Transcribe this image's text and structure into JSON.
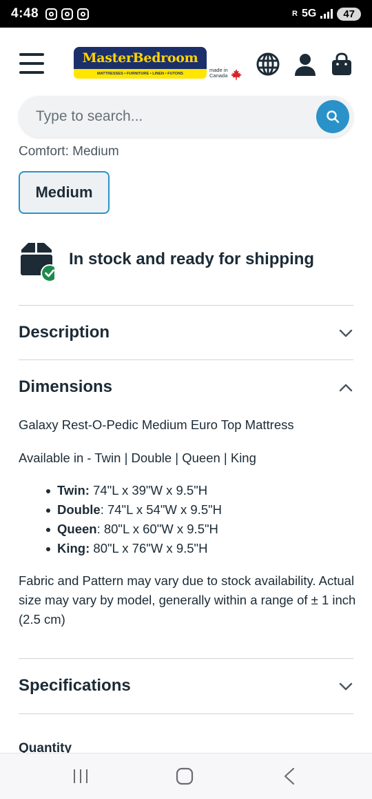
{
  "status_bar": {
    "time": "4:48",
    "network_label": "5G",
    "signal_label": "R",
    "battery": "47"
  },
  "header": {
    "logo_main": "MasterBedroom",
    "logo_tagline": "MATTRESSES  •  FURNITURE  •  LINEN  •  FUTONS",
    "made_in": "made in",
    "canada": "Canada",
    "icons": [
      "menu-icon",
      "globe-icon",
      "account-icon",
      "shopping-bag-icon"
    ]
  },
  "search": {
    "placeholder": "Type to search...",
    "value": ""
  },
  "comfort": {
    "label_partial": "Comfort: Medium",
    "option": "Medium"
  },
  "stock": {
    "text": "In stock and ready for shipping"
  },
  "accordions": {
    "description": "Description",
    "dimensions": "Dimensions",
    "specifications": "Specifications"
  },
  "dimensions": {
    "product_name": "Galaxy Rest-O-Pedic Medium Euro Top Mattress",
    "available": "Available in - Twin | Double | Queen | King",
    "sizes": [
      {
        "name": "Twin:",
        "value": " 74\"L x 39\"W x 9.5\"H"
      },
      {
        "name": "Double",
        "value": ": 74\"L x 54\"W x 9.5\"H"
      },
      {
        "name": "Queen",
        "value": ": 80\"L x 60\"W x 9.5\"H"
      },
      {
        "name": "King:",
        "value": " 80\"L x 76\"W x 9.5\"H"
      }
    ],
    "note": "Fabric and Pattern may vary due to stock availability. Actual size may vary by model, generally within a range of ± 1 inch (2.5 cm)"
  },
  "quantity_label": "Quantity",
  "colors": {
    "accent": "#2a92c8",
    "text": "#1c2b36",
    "check": "#1f8a4c",
    "logo_navy": "#1b2f6b",
    "logo_yellow": "#ffe600"
  },
  "nav_buttons": [
    "recent-apps-button",
    "home-button",
    "back-button"
  ]
}
